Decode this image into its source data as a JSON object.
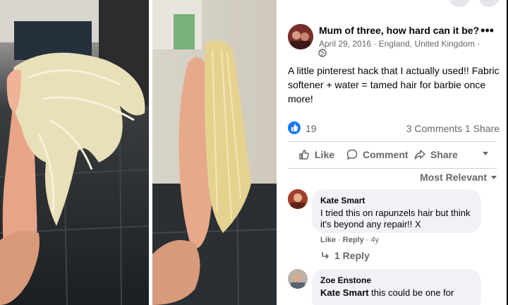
{
  "post": {
    "author": "Mum of three, how hard can it be?",
    "date": "April 29, 2016",
    "location": "England, United Kingdom",
    "meta_separator": " · ",
    "more": "•••",
    "text": "A little pinterest hack that I actually used!! Fabric softener + water = tamed hair for barbie once more!",
    "like_count": "19",
    "counts": "3 Comments  1 Share",
    "actions": {
      "like": "Like",
      "comment": "Comment",
      "share": "Share"
    },
    "sort_label": "Most Relevant",
    "accent_color": "#1877f2"
  },
  "comments": [
    {
      "name": "Kate Smart",
      "text": "I tried this on rapunzels hair but think it's beyond any repair!! X",
      "like": "Like",
      "reply": "Reply",
      "age": "4y",
      "replies_label": "1 Reply"
    },
    {
      "name": "Zoe Enstone",
      "mention": "Kate Smart",
      "text": " this could be one for"
    }
  ],
  "icons": {
    "globe": "globe-icon",
    "like": "thumbs-up-icon",
    "comment": "comment-bubble-icon",
    "share": "share-arrow-icon",
    "reply": "reply-arrow-icon"
  }
}
